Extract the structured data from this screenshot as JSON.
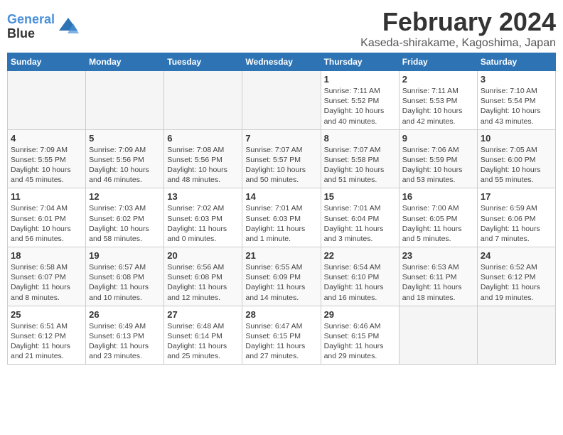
{
  "logo": {
    "line1": "General",
    "line2": "Blue"
  },
  "title": "February 2024",
  "subtitle": "Kaseda-shirakame, Kagoshima, Japan",
  "days_header": [
    "Sunday",
    "Monday",
    "Tuesday",
    "Wednesday",
    "Thursday",
    "Friday",
    "Saturday"
  ],
  "weeks": [
    [
      {
        "num": "",
        "info": ""
      },
      {
        "num": "",
        "info": ""
      },
      {
        "num": "",
        "info": ""
      },
      {
        "num": "",
        "info": ""
      },
      {
        "num": "1",
        "info": "Sunrise: 7:11 AM\nSunset: 5:52 PM\nDaylight: 10 hours\nand 40 minutes."
      },
      {
        "num": "2",
        "info": "Sunrise: 7:11 AM\nSunset: 5:53 PM\nDaylight: 10 hours\nand 42 minutes."
      },
      {
        "num": "3",
        "info": "Sunrise: 7:10 AM\nSunset: 5:54 PM\nDaylight: 10 hours\nand 43 minutes."
      }
    ],
    [
      {
        "num": "4",
        "info": "Sunrise: 7:09 AM\nSunset: 5:55 PM\nDaylight: 10 hours\nand 45 minutes."
      },
      {
        "num": "5",
        "info": "Sunrise: 7:09 AM\nSunset: 5:56 PM\nDaylight: 10 hours\nand 46 minutes."
      },
      {
        "num": "6",
        "info": "Sunrise: 7:08 AM\nSunset: 5:56 PM\nDaylight: 10 hours\nand 48 minutes."
      },
      {
        "num": "7",
        "info": "Sunrise: 7:07 AM\nSunset: 5:57 PM\nDaylight: 10 hours\nand 50 minutes."
      },
      {
        "num": "8",
        "info": "Sunrise: 7:07 AM\nSunset: 5:58 PM\nDaylight: 10 hours\nand 51 minutes."
      },
      {
        "num": "9",
        "info": "Sunrise: 7:06 AM\nSunset: 5:59 PM\nDaylight: 10 hours\nand 53 minutes."
      },
      {
        "num": "10",
        "info": "Sunrise: 7:05 AM\nSunset: 6:00 PM\nDaylight: 10 hours\nand 55 minutes."
      }
    ],
    [
      {
        "num": "11",
        "info": "Sunrise: 7:04 AM\nSunset: 6:01 PM\nDaylight: 10 hours\nand 56 minutes."
      },
      {
        "num": "12",
        "info": "Sunrise: 7:03 AM\nSunset: 6:02 PM\nDaylight: 10 hours\nand 58 minutes."
      },
      {
        "num": "13",
        "info": "Sunrise: 7:02 AM\nSunset: 6:03 PM\nDaylight: 11 hours\nand 0 minutes."
      },
      {
        "num": "14",
        "info": "Sunrise: 7:01 AM\nSunset: 6:03 PM\nDaylight: 11 hours\nand 1 minute."
      },
      {
        "num": "15",
        "info": "Sunrise: 7:01 AM\nSunset: 6:04 PM\nDaylight: 11 hours\nand 3 minutes."
      },
      {
        "num": "16",
        "info": "Sunrise: 7:00 AM\nSunset: 6:05 PM\nDaylight: 11 hours\nand 5 minutes."
      },
      {
        "num": "17",
        "info": "Sunrise: 6:59 AM\nSunset: 6:06 PM\nDaylight: 11 hours\nand 7 minutes."
      }
    ],
    [
      {
        "num": "18",
        "info": "Sunrise: 6:58 AM\nSunset: 6:07 PM\nDaylight: 11 hours\nand 8 minutes."
      },
      {
        "num": "19",
        "info": "Sunrise: 6:57 AM\nSunset: 6:08 PM\nDaylight: 11 hours\nand 10 minutes."
      },
      {
        "num": "20",
        "info": "Sunrise: 6:56 AM\nSunset: 6:08 PM\nDaylight: 11 hours\nand 12 minutes."
      },
      {
        "num": "21",
        "info": "Sunrise: 6:55 AM\nSunset: 6:09 PM\nDaylight: 11 hours\nand 14 minutes."
      },
      {
        "num": "22",
        "info": "Sunrise: 6:54 AM\nSunset: 6:10 PM\nDaylight: 11 hours\nand 16 minutes."
      },
      {
        "num": "23",
        "info": "Sunrise: 6:53 AM\nSunset: 6:11 PM\nDaylight: 11 hours\nand 18 minutes."
      },
      {
        "num": "24",
        "info": "Sunrise: 6:52 AM\nSunset: 6:12 PM\nDaylight: 11 hours\nand 19 minutes."
      }
    ],
    [
      {
        "num": "25",
        "info": "Sunrise: 6:51 AM\nSunset: 6:12 PM\nDaylight: 11 hours\nand 21 minutes."
      },
      {
        "num": "26",
        "info": "Sunrise: 6:49 AM\nSunset: 6:13 PM\nDaylight: 11 hours\nand 23 minutes."
      },
      {
        "num": "27",
        "info": "Sunrise: 6:48 AM\nSunset: 6:14 PM\nDaylight: 11 hours\nand 25 minutes."
      },
      {
        "num": "28",
        "info": "Sunrise: 6:47 AM\nSunset: 6:15 PM\nDaylight: 11 hours\nand 27 minutes."
      },
      {
        "num": "29",
        "info": "Sunrise: 6:46 AM\nSunset: 6:15 PM\nDaylight: 11 hours\nand 29 minutes."
      },
      {
        "num": "",
        "info": ""
      },
      {
        "num": "",
        "info": ""
      }
    ]
  ]
}
